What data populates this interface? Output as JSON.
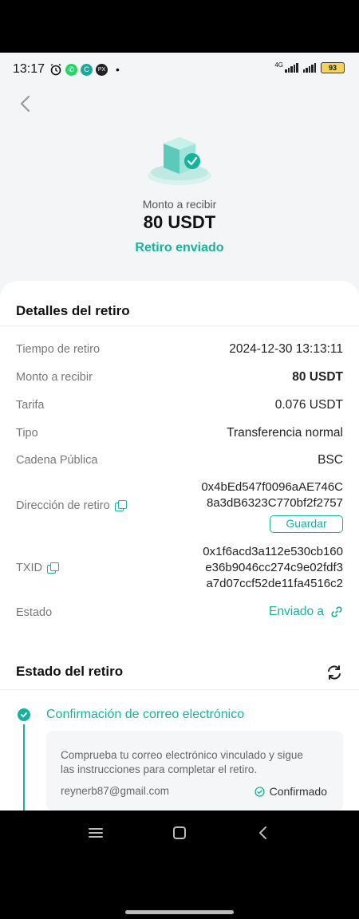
{
  "status_bar": {
    "time": "13:17",
    "network": "4G",
    "battery": "93"
  },
  "hero": {
    "amount_label": "Monto a recibir",
    "amount": "80 USDT",
    "status": "Retiro enviado"
  },
  "details": {
    "title": "Detalles del retiro",
    "rows": [
      {
        "label": "Tiempo de retiro",
        "value": "2024-12-30 13:13:11"
      },
      {
        "label": "Monto a recibir",
        "value": "80 USDT"
      },
      {
        "label": "Tarifa",
        "value": "0.076 USDT"
      },
      {
        "label": "Tipo",
        "value": "Transferencia normal"
      },
      {
        "label": "Cadena Pública",
        "value": "BSC"
      }
    ],
    "address": {
      "label": "Dirección de retiro",
      "lines": [
        "0x4bEd547f0096aAE746C",
        "8a3dB6323C770bf2f2757"
      ],
      "save_label": "Guardar"
    },
    "txid": {
      "label": "TXID",
      "lines": [
        "0x1f6acd3a112e530cb160",
        "e36b9046cc274c9e02fdf3",
        "a7d07ccf52de11fa4516c2"
      ]
    },
    "state": {
      "label": "Estado",
      "value": "Enviado a"
    }
  },
  "progress": {
    "title": "Estado del retiro",
    "steps": [
      {
        "title": "Confirmación de correo electrónico",
        "description": "Comprueba tu correo electrónico vinculado y sigue las instrucciones para completar el retiro.",
        "email": "reynerb87@gmail.com",
        "status": "Confirmado"
      }
    ]
  },
  "colors": {
    "accent": "#16b39c",
    "background": "#f4f5f6",
    "card": "#ffffff"
  }
}
